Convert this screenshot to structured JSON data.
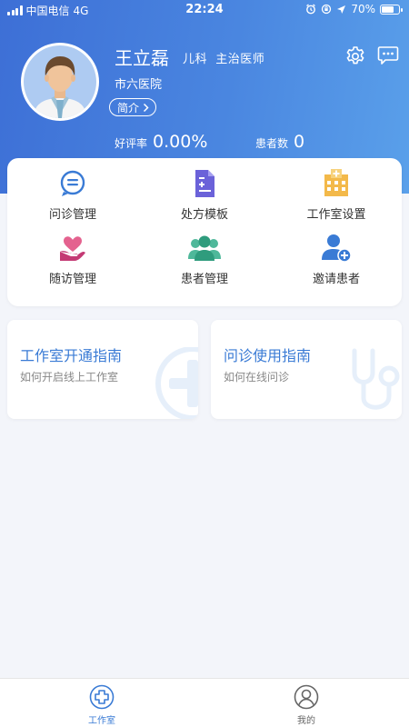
{
  "status_bar": {
    "carrier": "中国电信",
    "network": "4G",
    "time": "22:24",
    "battery": "70%",
    "battery_level": 0.7
  },
  "profile": {
    "name": "王立磊",
    "department_title": "儿科  主治医师",
    "hospital": "市六医院",
    "intro_label": "简介",
    "rating_label": "好评率",
    "rating_value": "0.00%",
    "patients_label": "患者数",
    "patients_value": "0"
  },
  "functions": [
    {
      "label": "问诊管理",
      "icon": "chat-bubble-icon"
    },
    {
      "label": "处方模板",
      "icon": "prescription-doc-icon"
    },
    {
      "label": "工作室设置",
      "icon": "clinic-building-icon"
    },
    {
      "label": "随访管理",
      "icon": "heart-hand-icon"
    },
    {
      "label": "患者管理",
      "icon": "patients-group-icon"
    },
    {
      "label": "邀请患者",
      "icon": "invite-user-icon"
    }
  ],
  "guides": [
    {
      "title": "工作室开通指南",
      "subtitle": "如何开启线上工作室",
      "icon": "medical-cross-icon"
    },
    {
      "title": "问诊使用指南",
      "subtitle": "如何在线问诊",
      "icon": "stethoscope-icon"
    }
  ],
  "tabs": [
    {
      "label": "工作室",
      "icon": "studio-icon",
      "active": true
    },
    {
      "label": "我的",
      "icon": "user-icon",
      "active": false
    }
  ],
  "colors": {
    "header_start": "#3d6fd6",
    "header_end": "#5aa0ea",
    "accent": "#3a7bd5",
    "background": "#f3f5fa"
  }
}
